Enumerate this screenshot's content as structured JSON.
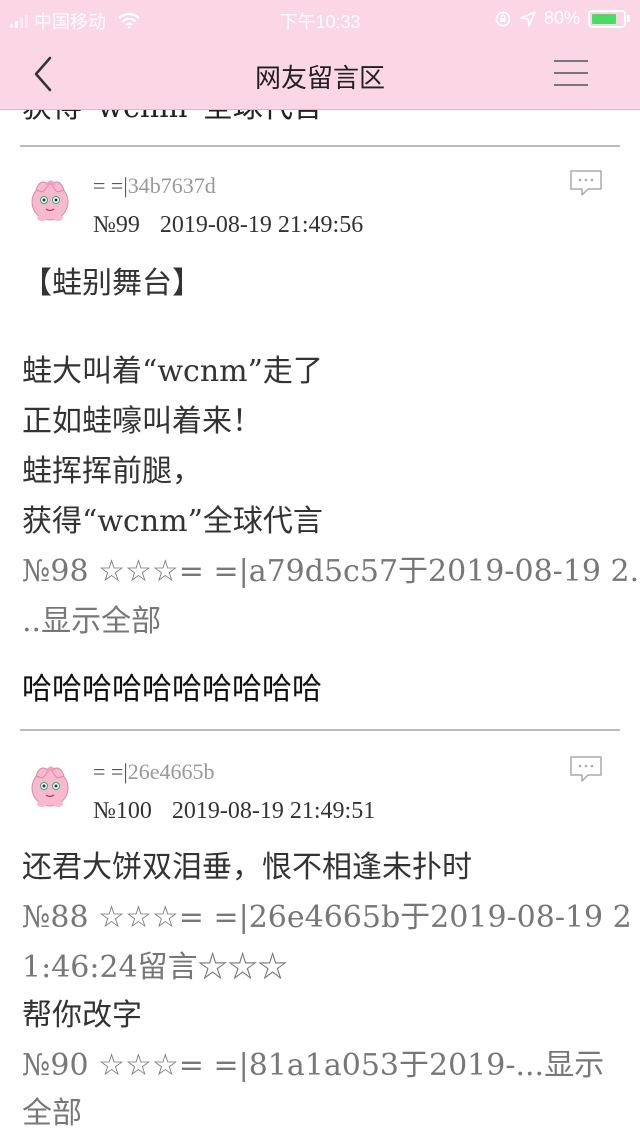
{
  "status_bar": {
    "carrier": "中国移动",
    "time": "下午10:33",
    "battery_percent": "80%",
    "battery_level": 0.8
  },
  "nav": {
    "title": "网友留言区"
  },
  "top_fragment": "获得“wcnm”全球代言",
  "posts": [
    {
      "uid_prefix": "= =|",
      "uid_hash": "34b7637d",
      "number": "№99",
      "date": "2019-08-19 21:49:56",
      "lines": [
        "【蛙别舞台】",
        "",
        "蛙大叫着“wcnm”走了",
        "正如蛙嚎叫着来！",
        "蛙挥挥前腿，",
        "获得“wcnm”全球代言"
      ],
      "quote_line1": "№98 ☆☆☆= =|a79d5c57于2019-08-19 2.",
      "quote_line2_prefix": "..",
      "quote_show_all": "显示全部",
      "reply": "哈哈哈哈哈哈哈哈哈哈"
    },
    {
      "uid_prefix": "= =|",
      "uid_hash": "26e4665b",
      "number": "№100",
      "date": "2019-08-19 21:49:51",
      "line1": "还君大饼双泪垂，恨不相逢未扑时",
      "quote_line1": "№88 ☆☆☆= =|26e4665b于2019-08-19 2",
      "quote_line2": "1:46:24留言☆☆☆",
      "line2": "帮你改字",
      "quote_line3": "№90 ☆☆☆= =|81a1a053于2019-...",
      "quote_show_all_a": "显示",
      "quote_show_all_b": "全部"
    }
  ],
  "icons": {
    "back": "chevron-left-icon",
    "menu": "hamburger-menu-icon",
    "comment": "comment-bubble-icon",
    "avatar": "jigglypuff-avatar"
  },
  "colors": {
    "header_bg": "#fbd6e4",
    "battery": "#4cd964",
    "avatar_pink": "#f7b9cf"
  }
}
